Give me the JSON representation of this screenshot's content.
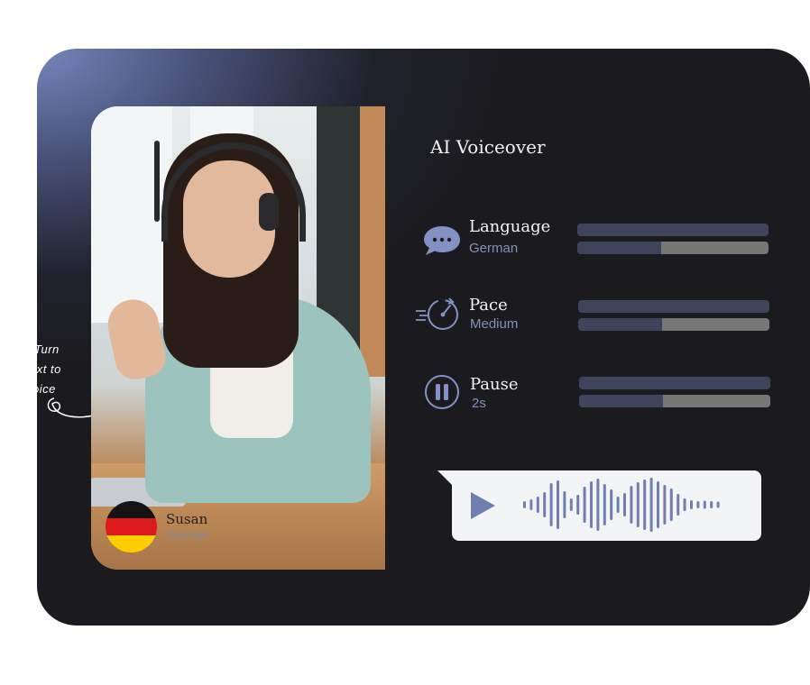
{
  "card": {
    "title": "AI Voiceover",
    "settings": [
      {
        "label": "Language",
        "value": "German",
        "icon": "speech-bubble-icon",
        "level": 0.44
      },
      {
        "label": "Pace",
        "value": "Medium",
        "icon": "speedometer-icon",
        "level": 0.44
      },
      {
        "label": "Pause",
        "value": "2s",
        "icon": "pause-icon",
        "level": 0.44
      }
    ]
  },
  "speaker": {
    "name": "Susan",
    "language": "German",
    "flag": "germany-flag"
  },
  "side_note": {
    "lines": [
      "Turn",
      "ext to",
      "oice"
    ]
  },
  "player": {
    "play_icon": "play-icon"
  },
  "colors": {
    "accent": "#7b8bc4",
    "panel_bg": "#1b1b1f",
    "bar_track": "#3e4459",
    "bar_fill": "#777777",
    "player_bg": "#f3f4f6",
    "waveform": "#6f7fb0"
  }
}
